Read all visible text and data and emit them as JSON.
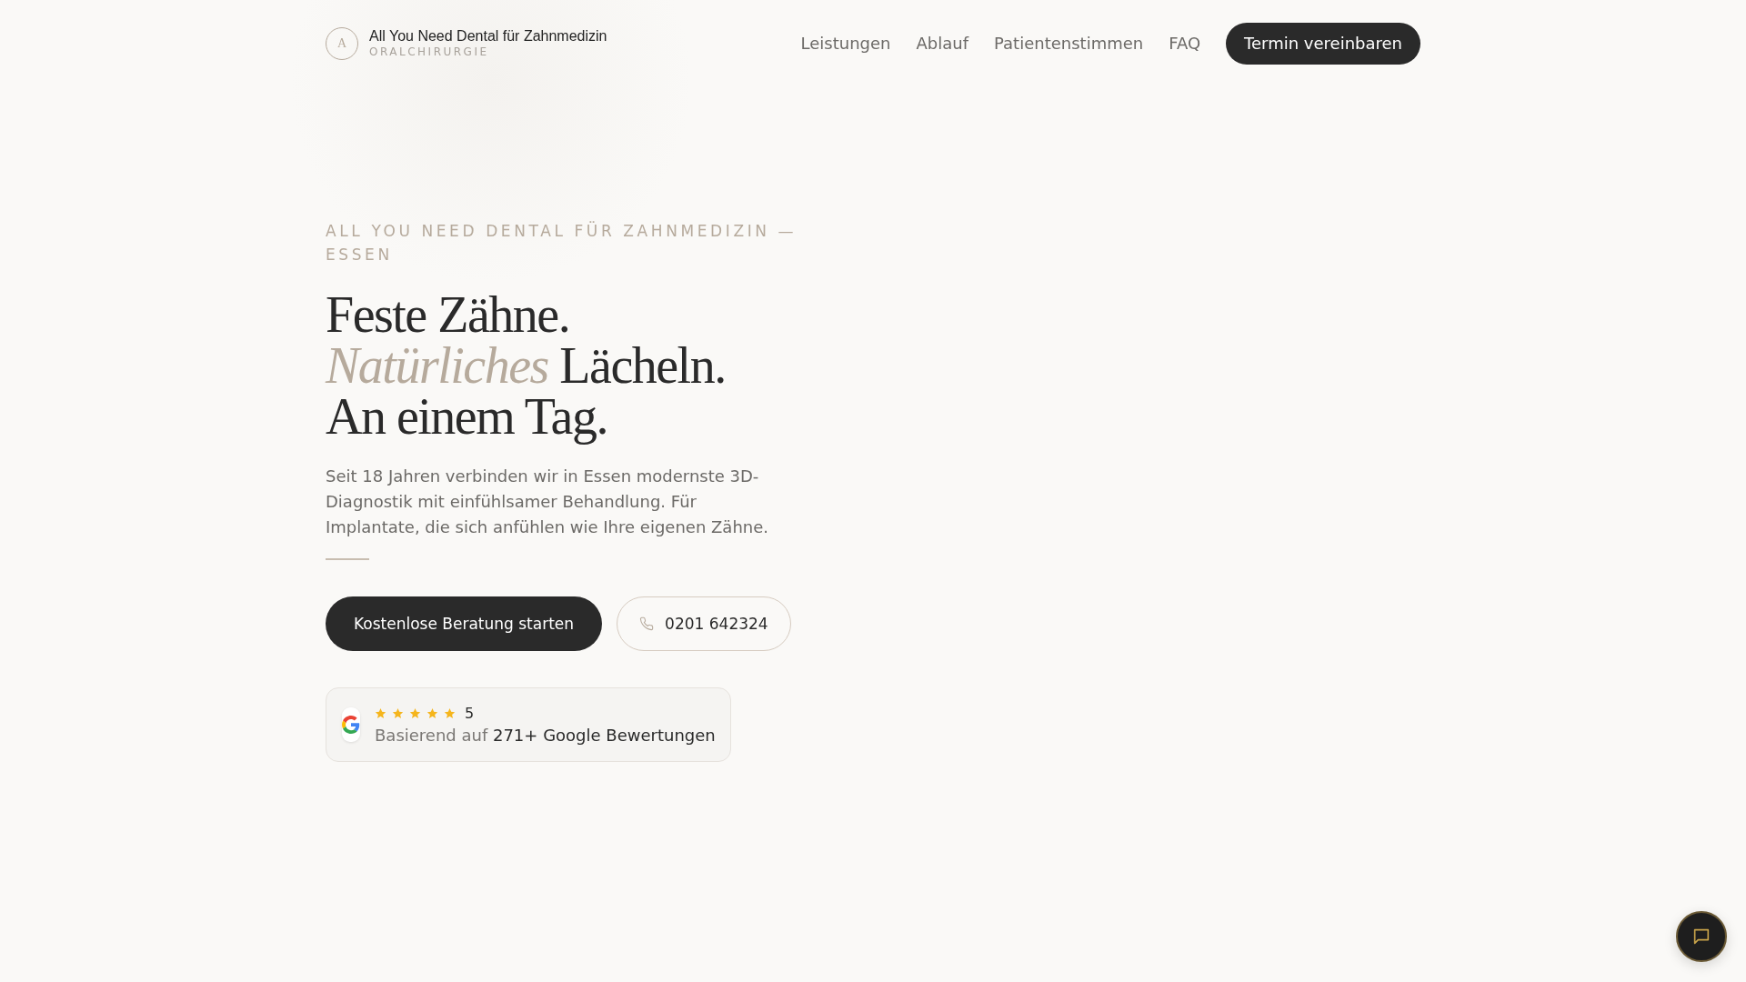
{
  "header": {
    "logo_letter": "A",
    "brand": "All You Need Dental für Zahnmedizin",
    "subtitle": "ORALCHIRURGIE",
    "nav": [
      "Leistungen",
      "Ablauf",
      "Patientenstimmen",
      "FAQ"
    ],
    "cta": "Termin vereinbaren"
  },
  "hero": {
    "eyebrow": "ALL YOU NEED DENTAL FÜR ZAHNMEDIZIN — ESSEN",
    "headline": [
      [
        {
          "text": "Feste Zähne.",
          "accent": false
        }
      ],
      [
        {
          "text": "Natürliches",
          "accent": true
        },
        {
          "text": " Lächeln.",
          "accent": false
        }
      ],
      [
        {
          "text": "An einem Tag.",
          "accent": false
        }
      ]
    ],
    "intro": "Seit 18 Jahren verbinden wir in Essen modernste 3D-Diagnostik mit einfühlsamer Behandlung. Für Implantate, die sich anfühlen wie Ihre eigenen Zähne.",
    "primary_button": "Kostenlose Beratung starten",
    "phone_button": "0201 642324",
    "review": {
      "stars": 5,
      "rating": "5",
      "text": "Basierend auf **271+ Google Bewertungen**"
    }
  }
}
